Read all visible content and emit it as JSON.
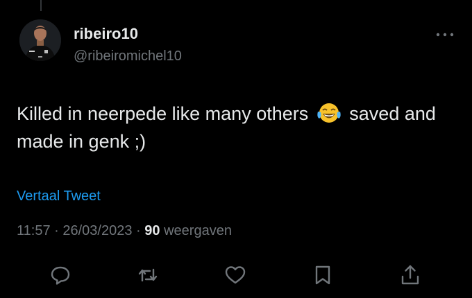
{
  "tweet": {
    "display_name": "ribeiro10",
    "handle": "@ribeiromichel10",
    "text_part1": "Killed in neerpede like many others",
    "emoji": "😂",
    "text_part2": "saved and made in genk ;)",
    "translate_label": "Vertaal Tweet",
    "time": "11:57",
    "separator": "·",
    "date": "26/03/2023",
    "view_count": "90",
    "view_label": "weergaven"
  },
  "actions": [
    {
      "name": "reply",
      "icon": "speech-bubble-icon"
    },
    {
      "name": "retweet",
      "icon": "retweet-icon"
    },
    {
      "name": "like",
      "icon": "heart-icon"
    },
    {
      "name": "bookmark",
      "icon": "bookmark-icon"
    },
    {
      "name": "share",
      "icon": "share-icon"
    }
  ],
  "colors": {
    "background": "#000000",
    "text": "#e7e9ea",
    "muted": "#71767b",
    "accent": "#1d9bf0"
  }
}
